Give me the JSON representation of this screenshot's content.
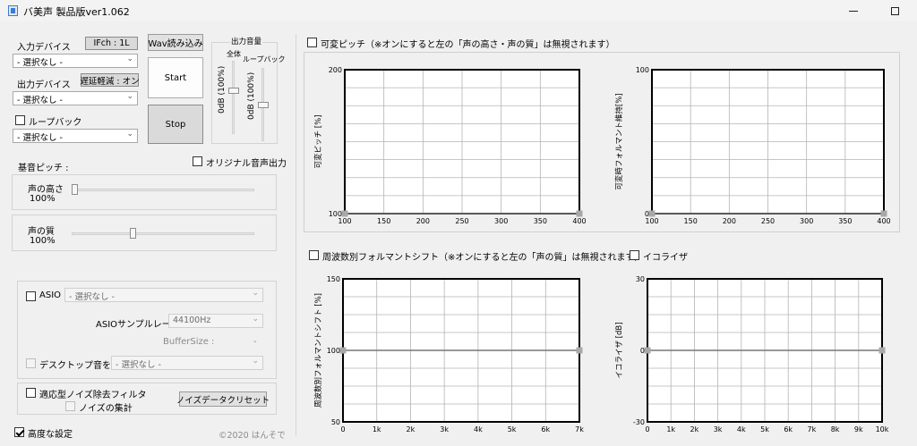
{
  "window": {
    "title": "バ美声 製品版ver1.062",
    "minimize_icon": "minimize-icon",
    "maximize_icon": "maximize-icon"
  },
  "left": {
    "input_device_label": "入力デバイス",
    "ifch_label": "IFch : 1L",
    "input_device_value": "- 選択なし -",
    "output_device_label": "出力デバイス",
    "latency_label": "遅延軽減 : オン",
    "output_device_value": "- 選択なし -",
    "loopback_label": "ループバック",
    "loopback_device_value": "- 選択なし -",
    "wav_load_label": "Wav読み込み",
    "start_label": "Start",
    "stop_label": "Stop",
    "output_volume_title": "出力音量",
    "master_label": "全体",
    "loopback_vol_label": "ループバック",
    "master_db": "0dB (100%)",
    "loopback_db": "0dB (100%)",
    "original_output_label": "オリジナル音声出力",
    "base_pitch_label": "基音ピッチ :",
    "voice_height_label": "声の高さ",
    "voice_height_value": "100%",
    "voice_quality_label": "声の質",
    "voice_quality_value": "100%",
    "asio_label": "ASIO",
    "asio_device_value": "- 選択なし -",
    "asio_rate_label": "ASIOサンプルレート :",
    "asio_rate_value": "44100Hz",
    "buffer_size_label": "BufferSize :",
    "buffer_size_value": "-",
    "desktop_add_label": "デスクトップ音を加算",
    "desktop_device_value": "- 選択なし -",
    "noise_filter_label": "適応型ノイズ除去フィルタ",
    "noise_collect_label": "ノイズの集計",
    "noise_clear_label": "ノイズデータクリセット",
    "advanced_label": "高度な設定",
    "copyright": "©2020 はんそで"
  },
  "state": {
    "loopback_checked": false,
    "original_output_checked": false,
    "asio_checked": false,
    "desktop_add_checked": false,
    "noise_filter_checked": false,
    "noise_collect_checked": false,
    "advanced_checked": true,
    "variable_pitch_checked": false,
    "freq_formant_checked": false,
    "equalizer_checked": false,
    "voice_height_level": 0.0,
    "voice_quality_level": 0.33,
    "master_volume_level": 0.6,
    "loopback_volume_level": 0.5
  },
  "right": {
    "variable_pitch_label": "可変ピッチ（※オンにすると左の「声の高さ・声の質」は無視されます）",
    "freq_formant_label": "周波数別フォルマントシフト（※オンにすると左の「声の質」は無視されます）",
    "equalizer_label": "イコライザ"
  },
  "chart_data": [
    {
      "type": "line",
      "ylabel": "可変ピッチ [%]",
      "x_ticks": [
        "100",
        "150",
        "200",
        "250",
        "300",
        "350",
        "400"
      ],
      "y_top": "200",
      "y_bottom": "100",
      "x": [
        100,
        400
      ],
      "y": [
        100,
        100
      ]
    },
    {
      "type": "line",
      "ylabel": "可変時フォルマント維持[%]",
      "x_ticks": [
        "100",
        "150",
        "200",
        "250",
        "300",
        "350",
        "400"
      ],
      "y_top": "100",
      "y_bottom": "0",
      "x": [
        100,
        400
      ],
      "y": [
        0,
        0
      ]
    },
    {
      "type": "line",
      "ylabel": "周波数別フォルマントシフト [%]",
      "x_ticks": [
        "0",
        "1k",
        "2k",
        "3k",
        "4k",
        "5k",
        "6k",
        "7k"
      ],
      "y_top": "150",
      "y_mid": "100",
      "y_bottom": "50",
      "x": [
        0,
        7000
      ],
      "y": [
        100,
        100
      ]
    },
    {
      "type": "line",
      "ylabel": "イコライザ [dB]",
      "x_ticks": [
        "0",
        "1k",
        "2k",
        "3k",
        "4k",
        "5k",
        "6k",
        "7k",
        "8k",
        "9k",
        "10k"
      ],
      "y_top": "30",
      "y_mid": "0",
      "y_bottom": "-30",
      "x": [
        0,
        10000
      ],
      "y": [
        0,
        0
      ]
    }
  ]
}
